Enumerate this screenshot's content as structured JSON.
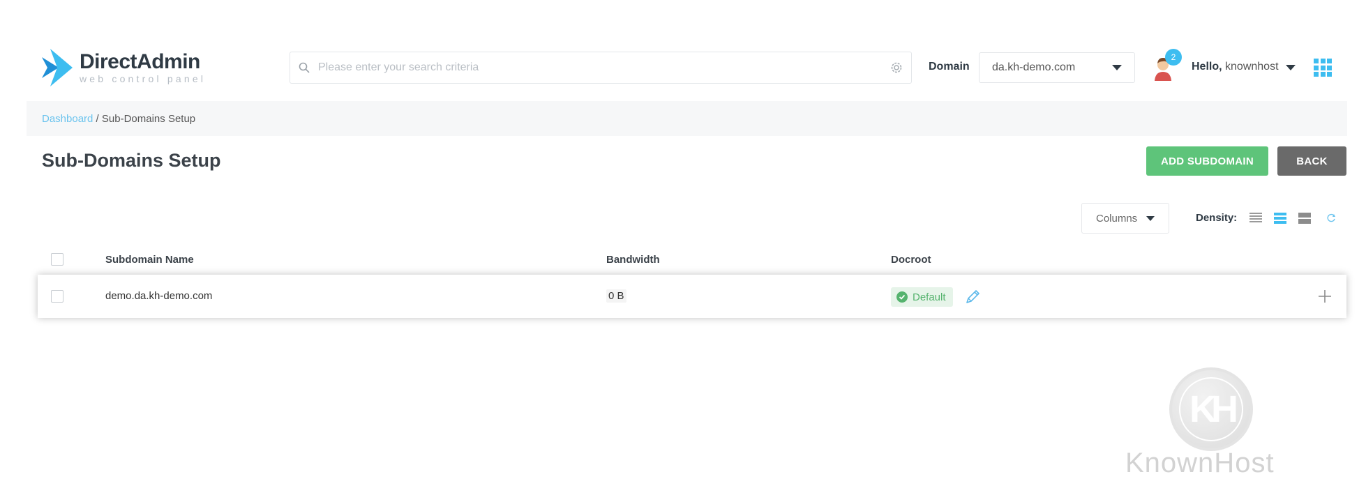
{
  "header": {
    "logo_title": "DirectAdmin",
    "logo_subtitle": "web control panel",
    "search_placeholder": "Please enter your search criteria",
    "domain_label": "Domain",
    "domain_value": "da.kh-demo.com",
    "notification_count": "2",
    "greeting": "Hello,",
    "username": "knownhost"
  },
  "breadcrumb": {
    "root": "Dashboard",
    "separator": " / ",
    "current": "Sub-Domains Setup"
  },
  "page": {
    "title": "Sub-Domains Setup",
    "add_button": "ADD SUBDOMAIN",
    "back_button": "BACK"
  },
  "toolbar": {
    "columns_label": "Columns",
    "density_label": "Density:",
    "active_density": "medium"
  },
  "table": {
    "columns": [
      "Subdomain Name",
      "Bandwidth",
      "Docroot"
    ],
    "rows": [
      {
        "subdomain": "demo.da.kh-demo.com",
        "bandwidth": "0 B",
        "docroot": "Default"
      }
    ]
  },
  "watermark": {
    "monogram": "KH",
    "text": "KnownHost"
  },
  "colors": {
    "accent": "#3dbdf0",
    "add_button": "#5ec47a",
    "back_button": "#6a6a6a",
    "default_badge": "#55b36e",
    "link": "#6cc4ee"
  }
}
